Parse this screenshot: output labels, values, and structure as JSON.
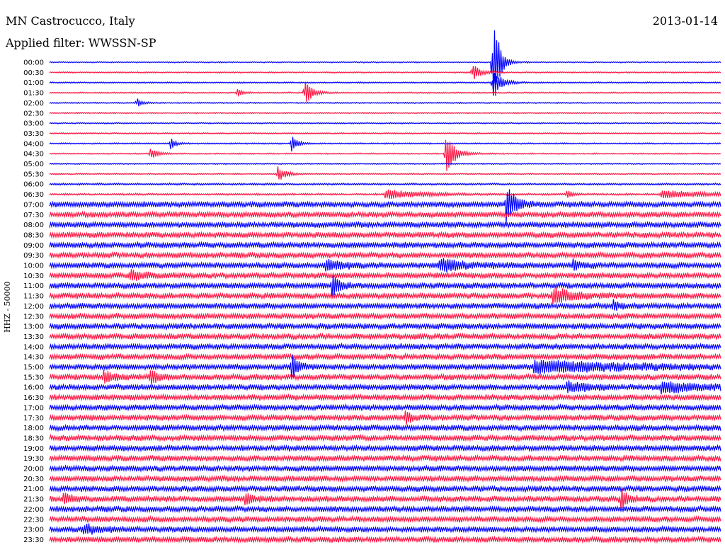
{
  "header": {
    "station": "MN Castrocucco, Italy",
    "date": "2013-01-14",
    "filter": "Applied filter: WWSSN-SP"
  },
  "chart_data": {
    "type": "line",
    "title": "MN Castrocucco, Italy",
    "subtitle": "Applied filter: WWSSN-SP",
    "ylabel": "HHZ - 50000",
    "colors": [
      "#0000ff",
      "#ff1744"
    ],
    "rows": [
      "00:00",
      "00:30",
      "01:00",
      "01:30",
      "02:00",
      "02:30",
      "03:00",
      "03:30",
      "04:00",
      "04:30",
      "05:00",
      "05:30",
      "06:00",
      "06:30",
      "07:00",
      "07:30",
      "08:00",
      "08:30",
      "09:00",
      "09:30",
      "10:00",
      "10:30",
      "11:00",
      "11:30",
      "12:00",
      "12:30",
      "13:00",
      "13:30",
      "14:00",
      "14:30",
      "15:00",
      "15:30",
      "16:00",
      "16:30",
      "17:00",
      "17:30",
      "18:00",
      "18:30",
      "19:00",
      "19:30",
      "20:00",
      "20:30",
      "21:00",
      "21:30",
      "22:00",
      "22:30",
      "23:00",
      "23:30"
    ],
    "noise": [
      1,
      1,
      1,
      1,
      1,
      1,
      1,
      1,
      1,
      1,
      1,
      1,
      1.5,
      1.5,
      4.5,
      4.5,
      4.5,
      4.5,
      4.5,
      4.5,
      4.5,
      4.5,
      4.5,
      4.5,
      4.5,
      4.5,
      4.5,
      4.5,
      4.5,
      4.5,
      4.5,
      4.5,
      4.5,
      4.5,
      4.5,
      4.5,
      4.5,
      4.5,
      4.5,
      4.5,
      4.5,
      4.5,
      4.5,
      4.5,
      4.5,
      4.5,
      4.5,
      4.5
    ],
    "events": [
      {
        "row": 0,
        "t": 0.66,
        "amp": 90,
        "dur": 0.008
      },
      {
        "row": 1,
        "t": 0.63,
        "amp": 14,
        "dur": 0.01
      },
      {
        "row": 2,
        "t": 0.66,
        "amp": 20,
        "dur": 0.012
      },
      {
        "row": 3,
        "t": 0.28,
        "amp": 7,
        "dur": 0.006
      },
      {
        "row": 3,
        "t": 0.38,
        "amp": 22,
        "dur": 0.01
      },
      {
        "row": 4,
        "t": 0.13,
        "amp": 7,
        "dur": 0.006
      },
      {
        "row": 8,
        "t": 0.18,
        "amp": 9,
        "dur": 0.006
      },
      {
        "row": 8,
        "t": 0.36,
        "amp": 13,
        "dur": 0.008
      },
      {
        "row": 9,
        "t": 0.15,
        "amp": 8,
        "dur": 0.01
      },
      {
        "row": 9,
        "t": 0.59,
        "amp": 32,
        "dur": 0.012
      },
      {
        "row": 11,
        "t": 0.34,
        "amp": 12,
        "dur": 0.01
      },
      {
        "row": 13,
        "t": 0.5,
        "amp": 7,
        "dur": 0.05
      },
      {
        "row": 13,
        "t": 0.77,
        "amp": 6,
        "dur": 0.008
      },
      {
        "row": 13,
        "t": 0.91,
        "amp": 6,
        "dur": 0.06
      },
      {
        "row": 14,
        "t": 0.68,
        "amp": 28,
        "dur": 0.012
      },
      {
        "row": 20,
        "t": 0.41,
        "amp": 9,
        "dur": 0.02
      },
      {
        "row": 20,
        "t": 0.58,
        "amp": 8,
        "dur": 0.04
      },
      {
        "row": 20,
        "t": 0.78,
        "amp": 8,
        "dur": 0.01
      },
      {
        "row": 21,
        "t": 0.12,
        "amp": 7,
        "dur": 0.02
      },
      {
        "row": 22,
        "t": 0.42,
        "amp": 16,
        "dur": 0.01
      },
      {
        "row": 23,
        "t": 0.75,
        "amp": 11,
        "dur": 0.03
      },
      {
        "row": 24,
        "t": 0.84,
        "amp": 8,
        "dur": 0.006
      },
      {
        "row": 30,
        "t": 0.36,
        "amp": 22,
        "dur": 0.008
      },
      {
        "row": 30,
        "t": 0.72,
        "amp": 8,
        "dur": 0.12
      },
      {
        "row": 31,
        "t": 0.08,
        "amp": 10,
        "dur": 0.012
      },
      {
        "row": 31,
        "t": 0.15,
        "amp": 11,
        "dur": 0.01
      },
      {
        "row": 32,
        "t": 0.77,
        "amp": 7,
        "dur": 0.03
      },
      {
        "row": 32,
        "t": 0.91,
        "amp": 7,
        "dur": 0.05
      },
      {
        "row": 35,
        "t": 0.53,
        "amp": 9,
        "dur": 0.01
      },
      {
        "row": 43,
        "t": 0.02,
        "amp": 9,
        "dur": 0.01
      },
      {
        "row": 43,
        "t": 0.29,
        "amp": 11,
        "dur": 0.01
      },
      {
        "row": 43,
        "t": 0.85,
        "amp": 16,
        "dur": 0.01
      },
      {
        "row": 46,
        "t": 0.05,
        "amp": 7,
        "dur": 0.02
      }
    ]
  }
}
